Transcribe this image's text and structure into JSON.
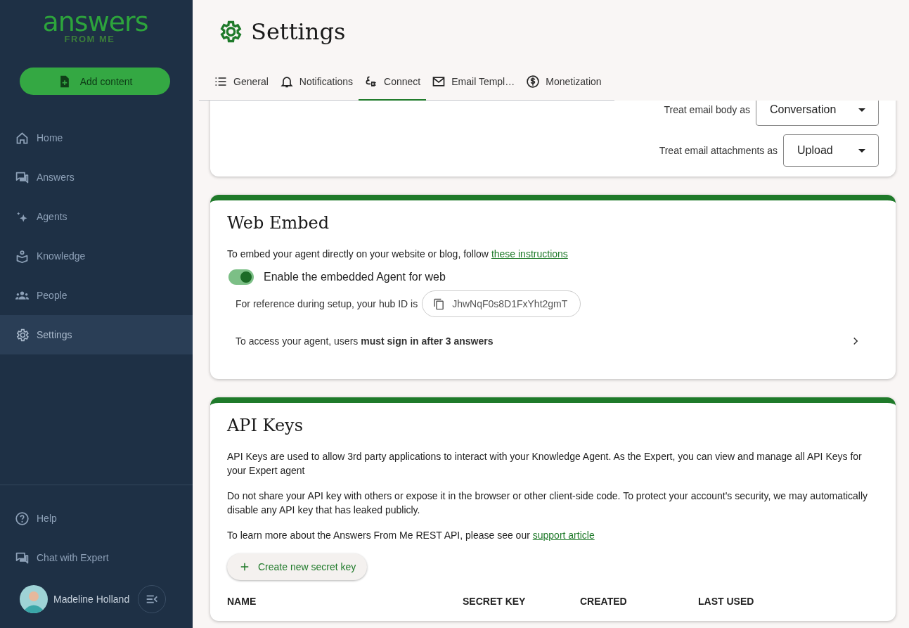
{
  "sidebar": {
    "logo": {
      "word": "answers",
      "tagline": "FROM ME"
    },
    "add_button": "Add content",
    "nav": [
      {
        "label": "Home",
        "selected": false
      },
      {
        "label": "Answers",
        "selected": false
      },
      {
        "label": "Agents",
        "selected": false
      },
      {
        "label": "Knowledge",
        "selected": false
      },
      {
        "label": "People",
        "selected": false
      },
      {
        "label": "Settings",
        "selected": true
      }
    ],
    "footer": [
      {
        "label": "Help"
      },
      {
        "label": "Chat with Expert"
      }
    ],
    "user": {
      "name": "Madeline Holland"
    }
  },
  "header": {
    "title": "Settings"
  },
  "tabs": [
    {
      "label": "General",
      "selected": false
    },
    {
      "label": "Notifications",
      "selected": false
    },
    {
      "label": "Connect",
      "selected": true
    },
    {
      "label": "Email Templ…",
      "selected": false
    },
    {
      "label": "Monetization",
      "selected": false
    }
  ],
  "email_card": {
    "rows": [
      {
        "label": "Treat email body as",
        "value": "Conversation"
      },
      {
        "label": "Treat email attachments as",
        "value": "Upload"
      }
    ]
  },
  "web_embed": {
    "title": "Web Embed",
    "intro": {
      "text": "To embed your agent directly on your website or blog, follow",
      "link": "these instructions"
    },
    "toggle": {
      "label": "Enable the embedded Agent for web",
      "on": true
    },
    "hub": {
      "label": "For reference during setup, your hub ID is",
      "id": "JhwNqF0s8D1FxYht2gmT"
    },
    "access": "To access your agent, users **must sign in after 3 answers**"
  },
  "api_keys": {
    "title": "API Keys",
    "paragraphs": [
      "API Keys are used to allow 3rd party applications to interact with your Knowledge Agent. As the Expert, you can view and manage all API Keys for your Expert agent",
      "Do not share your API key with others or expose it in the browser or other client-side code. To protect your account's security, we may automatically disable any API key that has leaked publicly."
    ],
    "support": {
      "text": "To learn more about the Answers From Me REST API, please see our",
      "link": "support article"
    },
    "button": "Create new secret key",
    "columns": [
      "NAME",
      "SECRET KEY",
      "CREATED",
      "LAST USED"
    ]
  }
}
